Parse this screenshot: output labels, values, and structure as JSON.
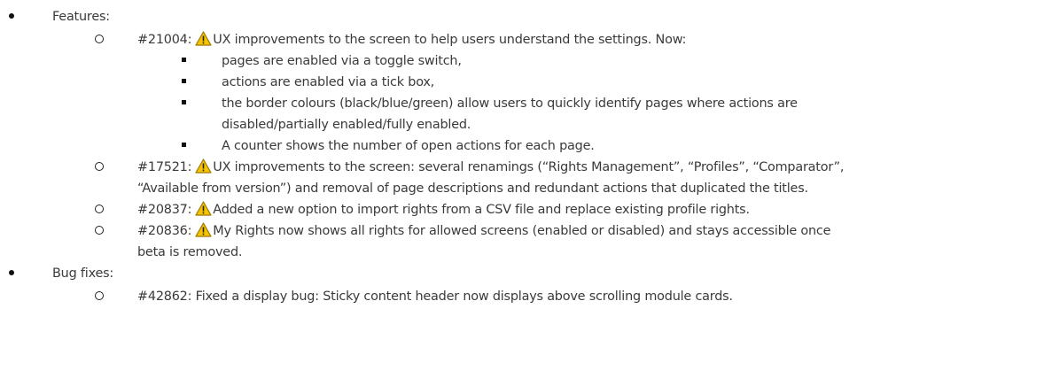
{
  "colors": {
    "text": "#3a3a3a",
    "warning_fill": "#f5c400",
    "warning_outline": "#a07800",
    "warning_mark": "#222222"
  },
  "sections": [
    {
      "heading": "Features:",
      "items": [
        {
          "id": "#21004:",
          "warning_icon": true,
          "text": "UX improvements to the screen to help users understand the settings. Now:",
          "subitems": [
            "pages are enabled via a toggle switch,",
            "actions are enabled via a tick box,",
            "the border colours (black/blue/green) allow users to quickly identify pages where actions are",
            "disabled/partially enabled/fully enabled.",
            "A counter shows the number of open actions for each page."
          ]
        },
        {
          "id": "#17521:",
          "warning_icon": true,
          "text": "UX improvements to the screen: several renamings (“Rights Management”, “Profiles”, “Comparator”,",
          "continuation": "“Available from version”) and removal of page descriptions and redundant actions that duplicated the titles."
        },
        {
          "id": "#20837:",
          "warning_icon": true,
          "text": "Added a new option to import rights from a CSV file and replace existing profile rights."
        },
        {
          "id": "#20836:",
          "warning_icon": true,
          "text": "My Rights now shows all rights for allowed screens (enabled or disabled) and stays accessible once",
          "continuation": "beta is removed."
        }
      ]
    },
    {
      "heading": "Bug fixes:",
      "items": [
        {
          "id": "#42862:",
          "warning_icon": false,
          "text": "Fixed a display bug: Sticky content header now displays above scrolling module cards."
        }
      ]
    }
  ]
}
